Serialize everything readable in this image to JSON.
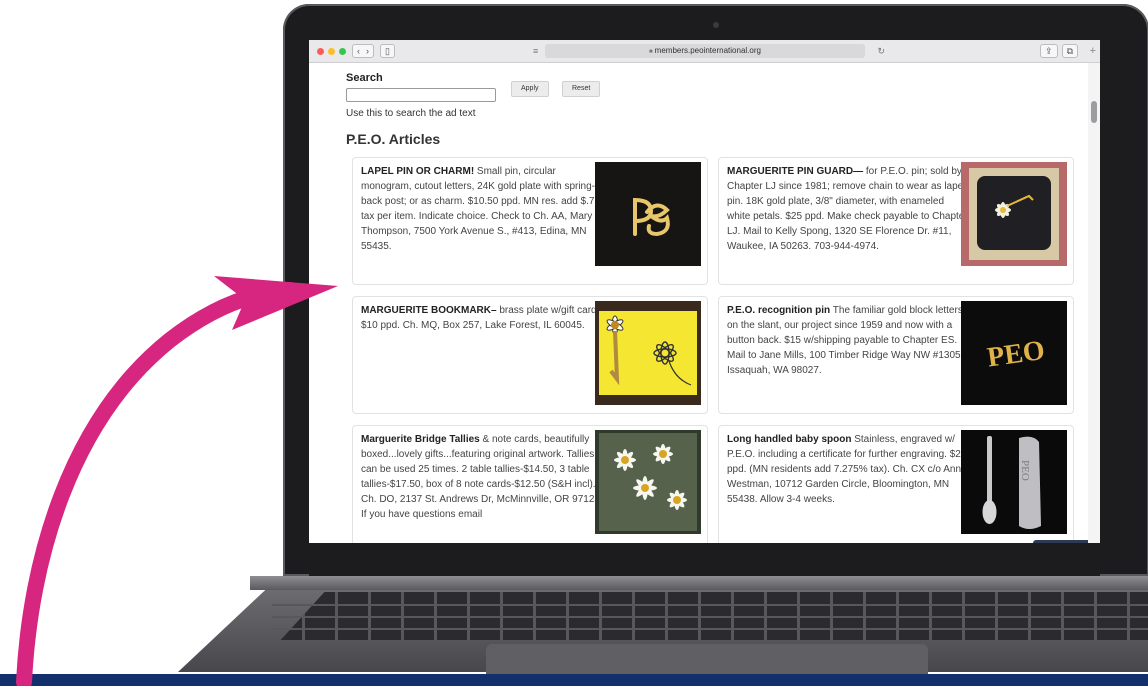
{
  "browser": {
    "url": "members.peointernational.org",
    "back_glyph": "‹",
    "forward_glyph": "›",
    "sidebar_glyph": "▯",
    "reader_glyph": "≡",
    "reload_glyph": "↻",
    "share_glyph": "⇪",
    "tabs_glyph": "⧉",
    "newtab_glyph": "+"
  },
  "search": {
    "label": "Search",
    "input_value": "",
    "apply_label": "Apply",
    "reset_label": "Reset",
    "help_text": "Use this to search the ad text"
  },
  "section_title": "P.E.O. Articles",
  "articles": [
    {
      "title": "LAPEL PIN OR CHARM!",
      "body": " Small pin, circular monogram, cutout letters, 24K gold plate with spring-back post; or as charm. $10.50 ppd. MN res. add $.76 tax per item. Indicate choice. Check to Ch. AA, Mary Thompson, 7500 York Avenue S., #413, Edina, MN 55435.",
      "image_icon": "gold-peo-monogram-pin"
    },
    {
      "title": "MARGUERITE PIN GUARD—",
      "body": " for P.E.O. pin; sold by Chapter LJ since 1981; remove chain to wear as lapel pin. 18K gold plate, 3/8\" diameter, with enameled white petals. $25 ppd. Make check payable to Chapter LJ. Mail to Kelly Spong, 1320 SE Florence Dr. #11, Waukee, IA 50263. 703-944-4974.",
      "image_icon": "marguerite-pin-in-box"
    },
    {
      "title": "MARGUERITE BOOKMARK–",
      "body": " brass plate w/gift card. $10 ppd. Ch. MQ, Box 257, Lake Forest, IL 60045.",
      "image_icon": "daisy-bookmark-card"
    },
    {
      "title": "P.E.O. recognition pin",
      "body": " The familiar gold block letters on the slant, our project since 1959 and now with a button back. $15 w/shipping payable to Chapter ES. Mail to Jane Mills, 100 Timber Ridge Way NW #1305, Issaquah, WA 98027.",
      "image_icon": "gold-peo-letters-pin"
    },
    {
      "title": "Marguerite Bridge Tallies",
      "body": " & note cards, beautifully boxed...lovely gifts...featuring original artwork. Tallies can be used 25 times. 2 table tallies-$14.50, 3 table tallies-$17.50, box of 8 note cards-$12.50 (S&H incl). Ch. DO, 2137 St. Andrews Dr, McMinnville, OR 97128. If you have questions email",
      "image_icon": "daisy-painting-card"
    },
    {
      "title": "Long handled baby spoon",
      "body": " Stainless, engraved w/ P.E.O. including a certificate for further engraving. $20 ppd. (MN residents add 7.275% tax). Ch. CX c/o Anne Westman, 10712 Garden Circle, Bloomington, MN 55438. Allow 3-4 weeks.",
      "image_icon": "engraved-baby-spoon"
    }
  ],
  "pin_letters": "PEO",
  "spoon_letters": "PEO",
  "colors": {
    "arrow": "#d6267f",
    "bottom_band": "#13306c",
    "laptop_frame": "#1c1c1e"
  }
}
